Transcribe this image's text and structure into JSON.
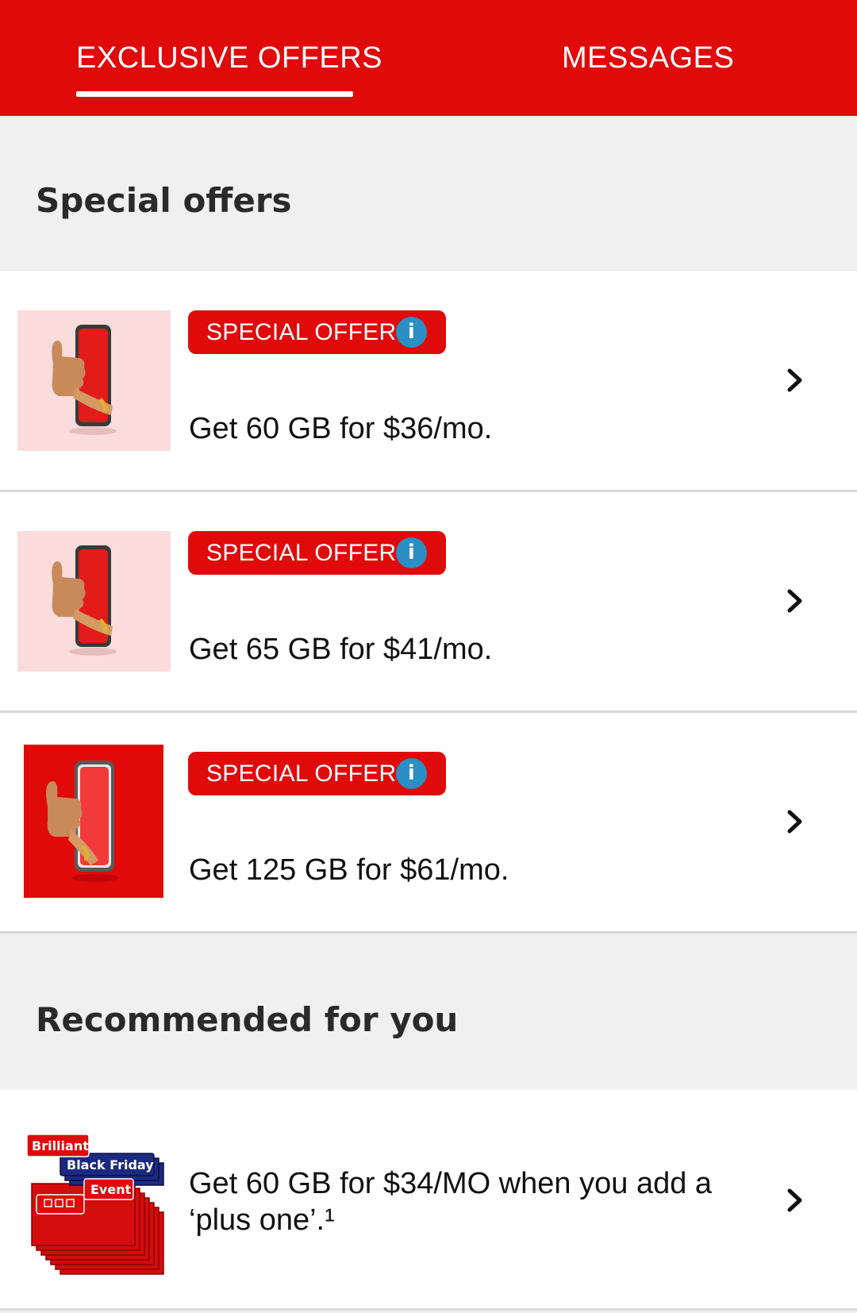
{
  "tabs": {
    "exclusive_offers": "EXCLUSIVE OFFERS",
    "messages": "MESSAGES",
    "active": "exclusive_offers"
  },
  "special_offers": {
    "title": "Special offers",
    "items": [
      {
        "badge": "SPECIAL OFFER",
        "info_icon": "i",
        "text": "Get 60 GB for $36/mo.",
        "thumb_bg": "#fbdcdc"
      },
      {
        "badge": "SPECIAL OFFER",
        "info_icon": "i",
        "text": "Get 65 GB for $41/mo.",
        "thumb_bg": "#fbdcdc"
      },
      {
        "badge": "SPECIAL OFFER",
        "info_icon": "i",
        "text": "Get 125 GB for $61/mo.",
        "thumb_bg": "#e00a0a"
      }
    ]
  },
  "recommended": {
    "title": "Recommended for you",
    "items": [
      {
        "text": "Get 60 GB for $34/MO when you add a ‘plus one’.¹",
        "thumb_labels": {
          "line1": "Brilliant",
          "line2": "Black Friday",
          "line3": "Event"
        }
      }
    ]
  },
  "colors": {
    "brand_red": "#e00a0a",
    "info_blue": "#2a8fc4",
    "page_bg": "#f0f0f0"
  },
  "icons": {
    "chevron": "chevron-right-icon",
    "info": "info-icon"
  }
}
